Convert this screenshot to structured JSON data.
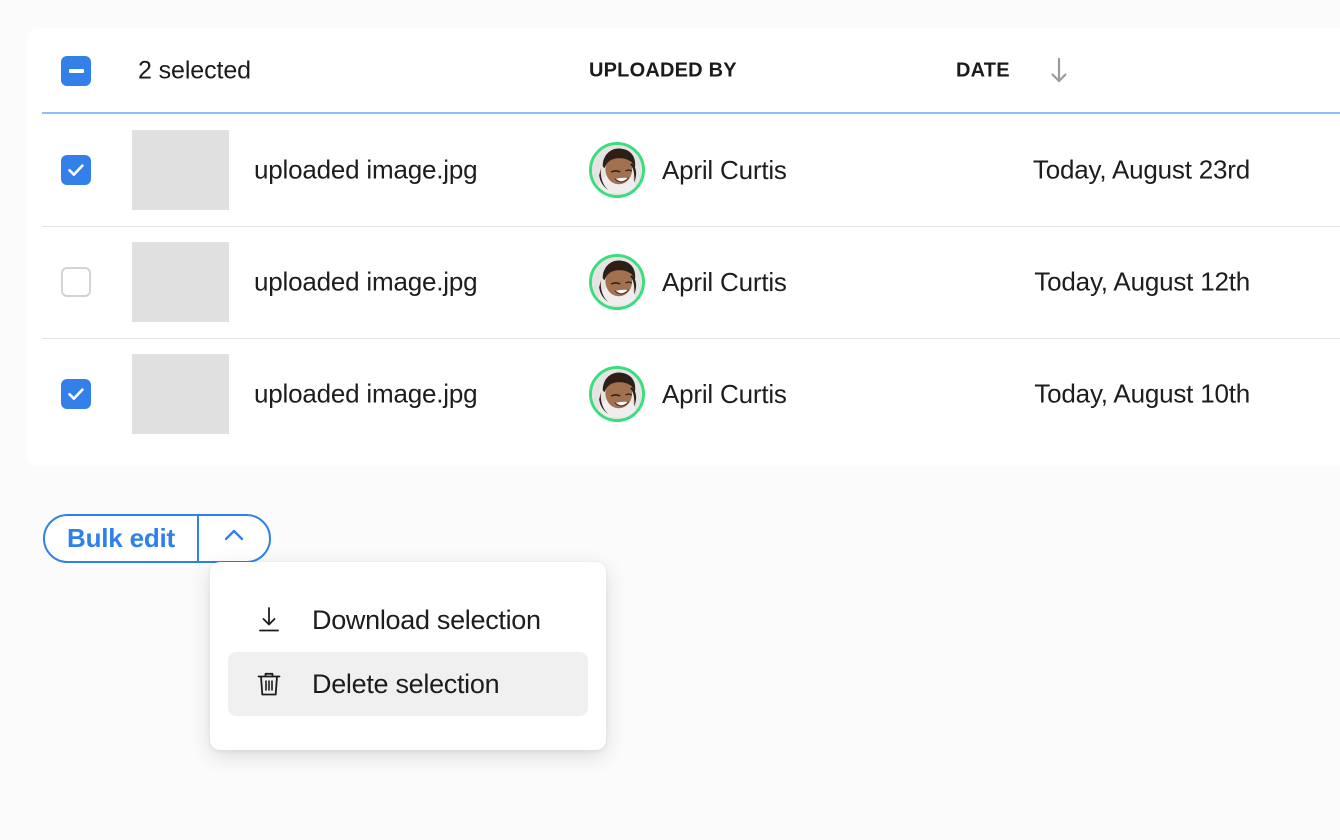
{
  "table": {
    "header": {
      "select_state": "indeterminate",
      "selection_label": "2 selected",
      "columns": {
        "uploaded_by": "UPLOADED BY",
        "date": "DATE"
      },
      "sort_icon": "arrow-down-icon",
      "sort_direction": "descending"
    },
    "rows": [
      {
        "checked": true,
        "thumbnail": "image-placeholder",
        "filename": "uploaded image.jpg",
        "uploader": "April Curtis",
        "avatar": "avatar-april-curtis",
        "date": "Today, August 23rd"
      },
      {
        "checked": false,
        "thumbnail": "image-placeholder",
        "filename": "uploaded image.jpg",
        "uploader": "April Curtis",
        "avatar": "avatar-april-curtis",
        "date": "Today, August 12th"
      },
      {
        "checked": true,
        "thumbnail": "image-placeholder",
        "filename": "uploaded image.jpg",
        "uploader": "April Curtis",
        "avatar": "avatar-april-curtis",
        "date": "Today, August 10th"
      }
    ]
  },
  "bulk_edit": {
    "label": "Bulk edit",
    "toggle_icon": "chevron-up-icon",
    "expanded": true
  },
  "menu": {
    "items": [
      {
        "label": "Download selection",
        "icon": "download-icon",
        "highlighted": false
      },
      {
        "label": "Delete selection",
        "icon": "trash-icon",
        "highlighted": true
      }
    ]
  },
  "colors": {
    "accent": "#2f80ed",
    "checkbox_fill": "#3381e8",
    "avatar_ring": "#3ade7f",
    "header_underline": "#90bdf6",
    "row_divider": "#e4e4e4",
    "thumbnail": "#e0e0e0",
    "page_background": "#fbfbfb",
    "card_background": "#ffffff",
    "menu_highlight": "#f0f0f0"
  }
}
